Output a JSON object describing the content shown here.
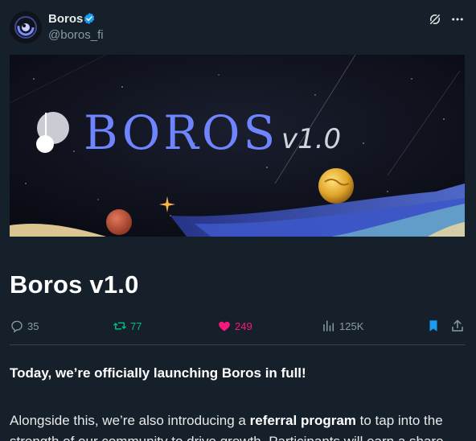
{
  "author": {
    "name": "Boros",
    "handle": "@boros_fi"
  },
  "banner": {
    "title": "BOROS",
    "version": "v1.0"
  },
  "article": {
    "title": "Boros v1.0"
  },
  "actions": {
    "replies": "35",
    "reposts": "77",
    "likes": "249",
    "views": "125K"
  },
  "body": {
    "intro": "Today, we’re officially launching Boros in full!",
    "p1_before": "Alongside this, we’re also introducing a ",
    "p1_bold": "referral program",
    "p1_after": " to tap into the strength of our community to drive growth. Participants will earn a share"
  },
  "colors": {
    "background": "#15202b",
    "verified": "#1d9bf0",
    "repost": "#00ba7c",
    "like": "#f91880",
    "bookmark": "#1d9bf0"
  }
}
